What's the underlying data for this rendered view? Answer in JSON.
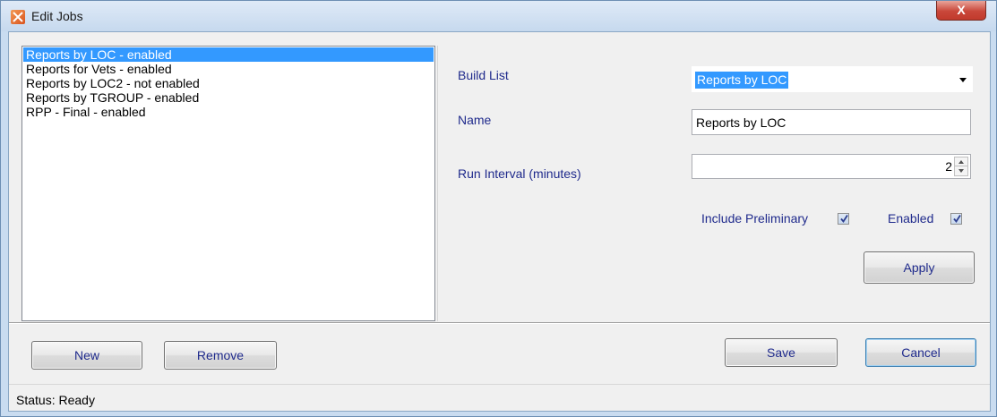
{
  "window": {
    "title": "Edit Jobs",
    "close_label": "X"
  },
  "jobs": {
    "items": [
      {
        "label": "Reports by LOC - enabled",
        "selected": true
      },
      {
        "label": "Reports for Vets - enabled",
        "selected": false
      },
      {
        "label": "Reports by LOC2 - not enabled",
        "selected": false
      },
      {
        "label": "Reports by TGROUP - enabled",
        "selected": false
      },
      {
        "label": "RPP - Final - enabled",
        "selected": false
      }
    ]
  },
  "form": {
    "build_list_label": "Build List",
    "build_list_value": "Reports by LOC",
    "name_label": "Name",
    "name_value": "Reports by LOC",
    "run_interval_label": "Run Interval (minutes)",
    "run_interval_value": "2",
    "include_preliminary_label": "Include Preliminary",
    "include_preliminary_checked": true,
    "enabled_label": "Enabled",
    "enabled_checked": true,
    "apply_label": "Apply"
  },
  "buttons": {
    "new_label": "New",
    "remove_label": "Remove",
    "save_label": "Save",
    "cancel_label": "Cancel"
  },
  "status": {
    "text": "Status: Ready"
  },
  "colors": {
    "selection": "#3399ff",
    "label_text": "#1f2a8c",
    "close_button": "#c9473a"
  },
  "icons": {
    "app": "app-logo-icon",
    "close": "close-icon",
    "dropdown": "chevron-down-icon",
    "checkmark": "check-icon"
  }
}
